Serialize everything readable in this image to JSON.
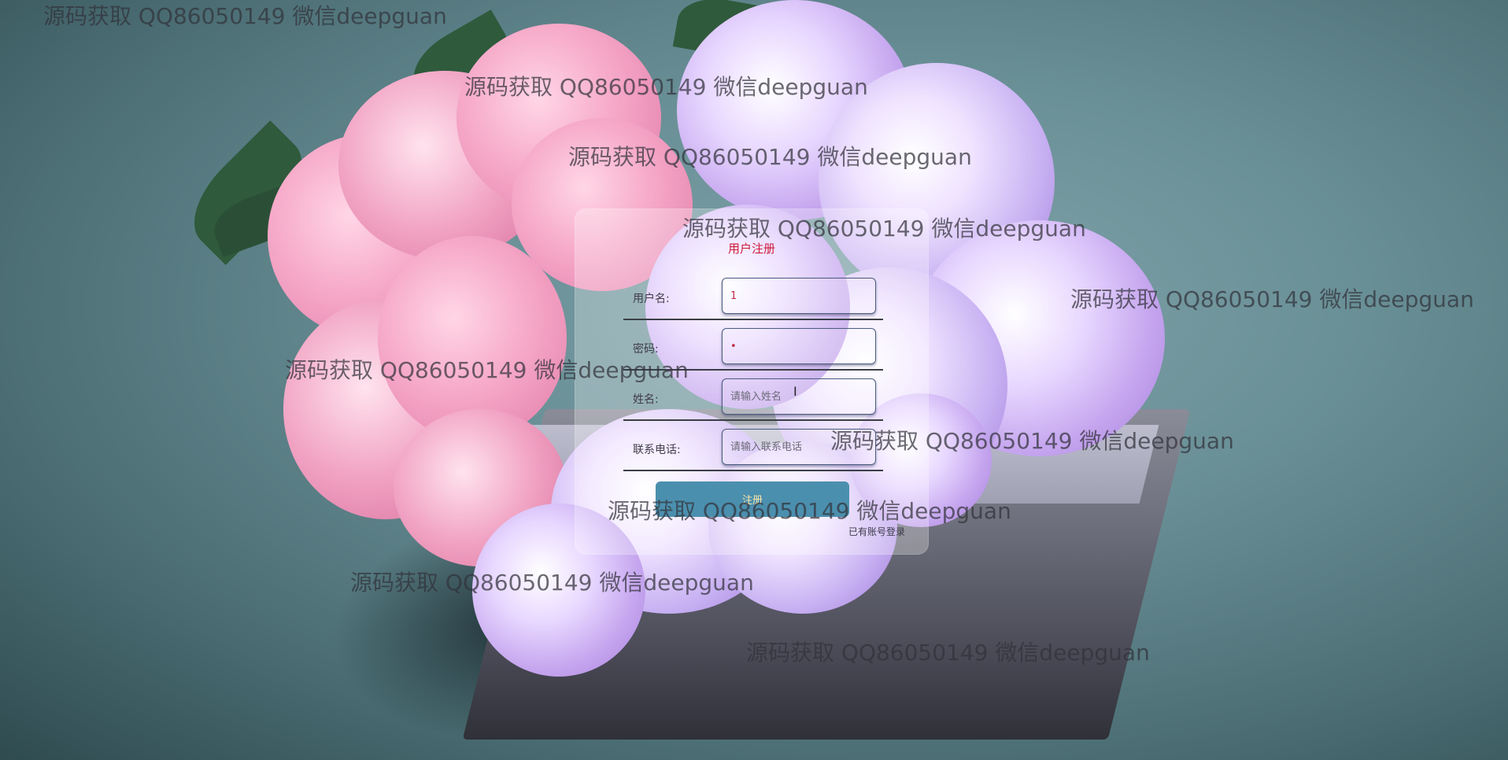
{
  "form": {
    "title": "用户注册",
    "fields": [
      {
        "label": "用户名:",
        "value": "1",
        "placeholder": ""
      },
      {
        "label": "密码:",
        "value": "•",
        "placeholder": ""
      },
      {
        "label": "姓名:",
        "value": "",
        "placeholder": "请输入姓名"
      },
      {
        "label": "联系电话:",
        "value": "",
        "placeholder": "请输入联系电话"
      }
    ],
    "submit_label": "注册",
    "login_link": "已有账号登录"
  },
  "watermark": {
    "text": "源码获取 QQ86050149 微信deepguan"
  },
  "colors": {
    "title": "#d0193c",
    "button": "#4b8fae",
    "button_text": "#ffe7a8"
  }
}
